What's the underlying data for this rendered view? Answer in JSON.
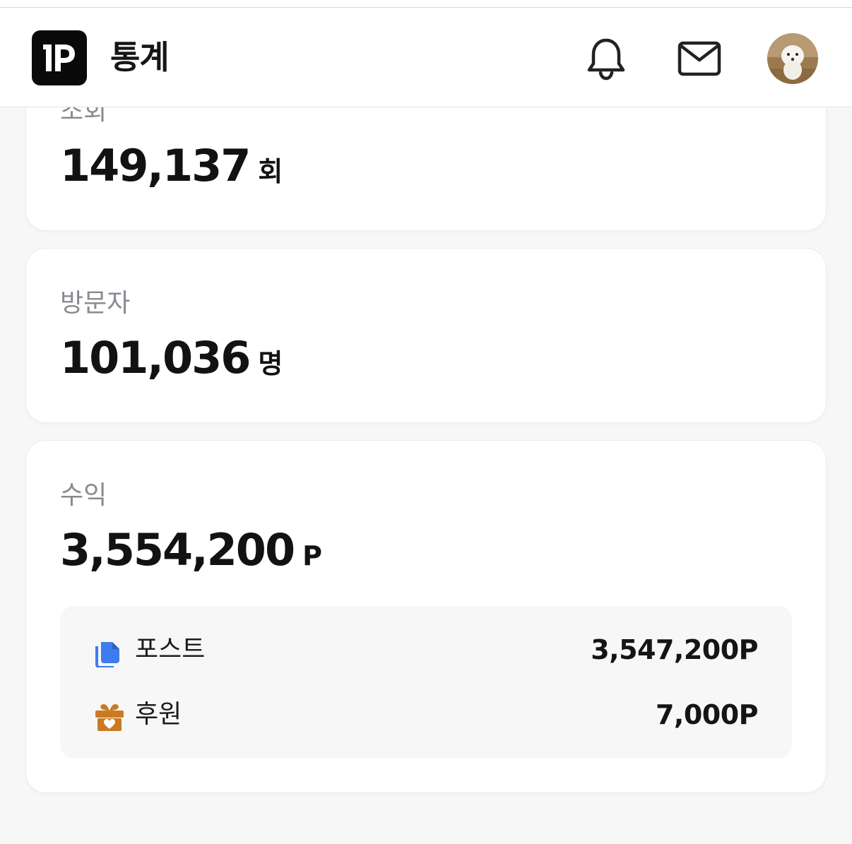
{
  "header": {
    "title": "통계",
    "logo_icon": "tp-logo-icon",
    "notification_icon": "bell-icon",
    "messages_icon": "mail-icon",
    "avatar": "profile-avatar"
  },
  "stats": {
    "views": {
      "label": "조회",
      "value": "149,137",
      "unit": "회"
    },
    "visitors": {
      "label": "방문자",
      "value": "101,036",
      "unit": "명"
    },
    "revenue": {
      "label": "수익",
      "value": "3,554,200",
      "unit": "P",
      "breakdown": [
        {
          "icon": "documents-icon",
          "label": "포스트",
          "value": "3,547,200P"
        },
        {
          "icon": "gift-icon",
          "label": "후원",
          "value": "7,000P"
        }
      ]
    }
  },
  "colors": {
    "accent_blue": "#3f7bf0",
    "gift_orange": "#c97a22",
    "label_gray": "#8a8a91",
    "background": "#f7f7f8"
  }
}
